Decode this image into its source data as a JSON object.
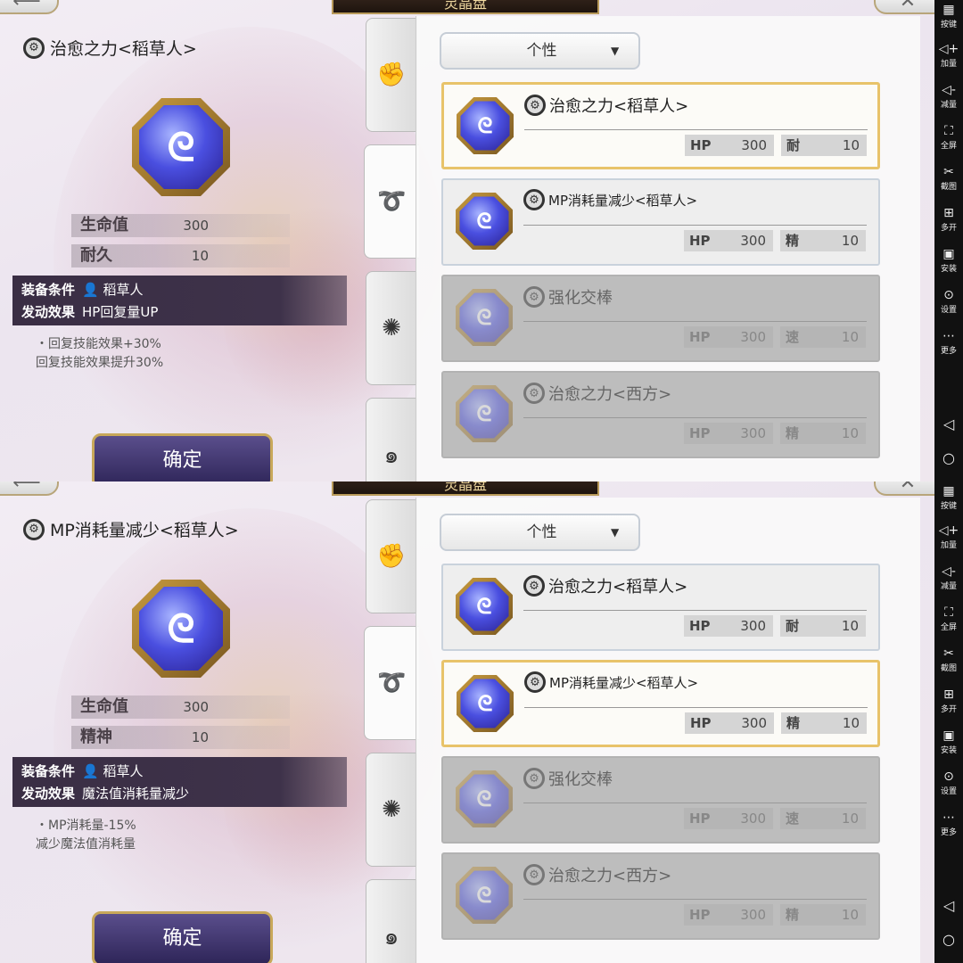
{
  "app": {
    "title": "灵晶盘"
  },
  "tabs": [
    {
      "name": "fist",
      "glyph": "✊"
    },
    {
      "name": "spiral",
      "glyph": "➰"
    },
    {
      "name": "star",
      "glyph": "✺"
    },
    {
      "name": "swirl",
      "glyph": "๑"
    }
  ],
  "dropdown": {
    "value": "个性",
    "arrow": "▼"
  },
  "confirm_label": "确定",
  "screens": [
    {
      "detail": {
        "name": "治愈之力<稻草人>",
        "stat1_label": "生命值",
        "stat1_value": "300",
        "stat2_label": "耐久",
        "stat2_value": "10",
        "cond_label": "装备条件",
        "cond_value": "稻草人",
        "effect_label": "发动效果",
        "effect_value": "HP回复量UP",
        "desc1": "・回复技能效果+30%",
        "desc2": "回复技能效果提升30%"
      }
    },
    {
      "detail": {
        "name": "MP消耗量减少<稻草人>",
        "stat1_label": "生命值",
        "stat1_value": "300",
        "stat2_label": "精神",
        "stat2_value": "10",
        "cond_label": "装备条件",
        "cond_value": "稻草人",
        "effect_label": "发动效果",
        "effect_value": "魔法值消耗量减少",
        "desc1": "・MP消耗量-15%",
        "desc2": "减少魔法值消耗量"
      }
    }
  ],
  "cards": [
    {
      "name": "治愈之力<稻草人>",
      "hp_label": "HP",
      "hp": "300",
      "stat_label": "耐",
      "stat": "10"
    },
    {
      "name": "MP消耗量减少<稻草人>",
      "hp_label": "HP",
      "hp": "300",
      "stat_label": "精",
      "stat": "10"
    },
    {
      "name": "强化交棒",
      "hp_label": "HP",
      "hp": "300",
      "stat_label": "速",
      "stat": "10"
    },
    {
      "name": "治愈之力<西方>",
      "hp_label": "HP",
      "hp": "300",
      "stat_label": "精",
      "stat": "10"
    }
  ],
  "sidebar": [
    {
      "icon": "▦",
      "label": "按键"
    },
    {
      "icon": "◁+",
      "label": "加量"
    },
    {
      "icon": "◁-",
      "label": "减量"
    },
    {
      "icon": "⛶",
      "label": "全屏"
    },
    {
      "icon": "✂",
      "label": "截图"
    },
    {
      "icon": "⊞",
      "label": "多开"
    },
    {
      "icon": "▣",
      "label": "安装"
    },
    {
      "icon": "⊙",
      "label": "设置"
    },
    {
      "icon": "⋯",
      "label": "更多"
    }
  ],
  "nav": {
    "back": "◁",
    "home": "○"
  },
  "colors": {
    "selected_border": "#e8c36a",
    "confirm_bg": "#3e3470",
    "cond_bg": "#3a2e44"
  }
}
